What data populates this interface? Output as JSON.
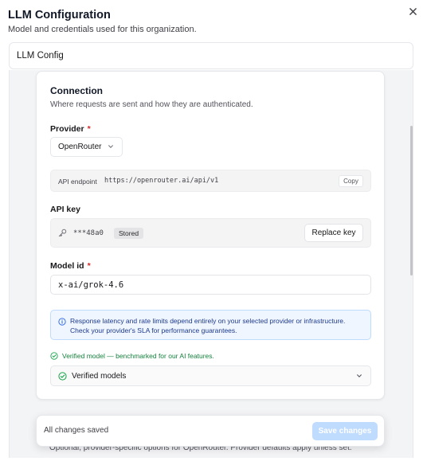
{
  "dialog": {
    "title": "LLM Configuration",
    "subtitle": "Model and credentials used for this organization.",
    "close_icon": "close-icon"
  },
  "tabs": [
    {
      "label": "LLM Config"
    }
  ],
  "connection": {
    "title": "Connection",
    "description": "Where requests are sent and how they are authenticated.",
    "provider": {
      "label": "Provider",
      "required_marker": "*",
      "selected": "OpenRouter"
    },
    "endpoint": {
      "label": "API endpoint",
      "value": "https://openrouter.ai/api/v1",
      "copy_label": "Copy"
    },
    "api_key": {
      "label": "API key",
      "masked_value": "***48a0",
      "badge": "Stored",
      "replace_label": "Replace key",
      "icon": "key-icon"
    },
    "model": {
      "label": "Model id",
      "required_marker": "*",
      "value": "x-ai/grok-4.6"
    },
    "info_notice": "Response latency and rate limits depend entirely on your selected provider or infrastructure. Check your provider's SLA for performance guarantees.",
    "verified_note": "Verified model — benchmarked for our AI features.",
    "verified_accordion_label": "Verified models"
  },
  "advanced_partial_text": "Optional, provider-specific options for OpenRouter. Provider defaults apply unless set.",
  "save_bar": {
    "status": "All changes saved",
    "save_label": "Save changes"
  },
  "colors": {
    "accent": "#60a5fa",
    "save_disabled": "#bfdbfe",
    "required": "#dc2626",
    "success": "#15803d",
    "info_bg": "#eff6ff",
    "info_text": "#1e3a8a"
  }
}
